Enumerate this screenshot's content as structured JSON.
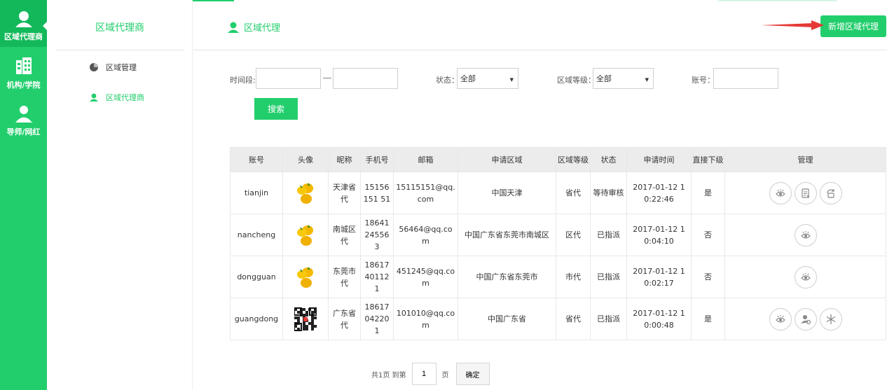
{
  "rail": {
    "items": [
      {
        "label": "区域代理商",
        "icon": "agent-icon",
        "active": true
      },
      {
        "label": "机构/学院",
        "icon": "building-icon",
        "active": false
      },
      {
        "label": "导师/网红",
        "icon": "user-icon",
        "active": false
      }
    ]
  },
  "sidebar": {
    "title": "区域代理商",
    "items": [
      {
        "label": "区域管理",
        "icon": "pie-chart-icon"
      },
      {
        "label": "区域代理商",
        "icon": "agent-icon"
      }
    ]
  },
  "header": {
    "breadcrumb": "区域代理",
    "add_button": "新增区域代理"
  },
  "filters": {
    "time_label": "时间段:",
    "status_label": "状态：",
    "status_value": "全部",
    "level_label": "区域等级：",
    "level_value": "全部",
    "account_label": "账号：",
    "search_button": "搜索"
  },
  "table": {
    "headers": [
      "账号",
      "头像",
      "昵称",
      "手机号",
      "邮箱",
      "申请区域",
      "区域等级",
      "状态",
      "申请时间",
      "直接下级",
      "管理"
    ],
    "rows": [
      {
        "account": "tianjin",
        "avatar": "fruit",
        "nickname": "天津省代",
        "phone": "15156151 51",
        "email": "15115151@qq.com",
        "region": "中国天津",
        "level": "省代",
        "status": "等待审核",
        "time": "2017-01-12 10:22:46",
        "sub": "是",
        "actions": [
          "eye-icon",
          "document-icon",
          "rotate-icon"
        ]
      },
      {
        "account": "nancheng",
        "avatar": "fruit",
        "nickname": "南城区代",
        "phone": "18641245563",
        "email": "56464@qq.com",
        "region": "中国广东省东莞市南城区",
        "level": "区代",
        "status": "已指派",
        "time": "2017-01-12 10:04:10",
        "sub": "否",
        "actions": [
          "eye-icon"
        ]
      },
      {
        "account": "dongguan",
        "avatar": "fruit",
        "nickname": "东莞市代",
        "phone": "18617401121",
        "email": "451245@qq.com",
        "region": "中国广东省东莞市",
        "level": "市代",
        "status": "已指派",
        "time": "2017-01-12 10:02:17",
        "sub": "否",
        "actions": [
          "eye-icon"
        ]
      },
      {
        "account": "guangdong",
        "avatar": "qrcode",
        "nickname": "广东省代",
        "phone": "18617042201",
        "email": "101010@qq.com",
        "region": "中国广东省",
        "level": "省代",
        "status": "已指派",
        "time": "2017-01-12 10:00:48",
        "sub": "是",
        "actions": [
          "eye-icon",
          "assign-user-icon",
          "snowflake-icon"
        ]
      }
    ]
  },
  "pager": {
    "total_text": "共1页 到第",
    "page": "1",
    "page_suffix": "页",
    "confirm": "确定"
  },
  "colors": {
    "accent": "#22ce6c",
    "rail_active": "#12b85a",
    "arrow": "#e53935"
  }
}
